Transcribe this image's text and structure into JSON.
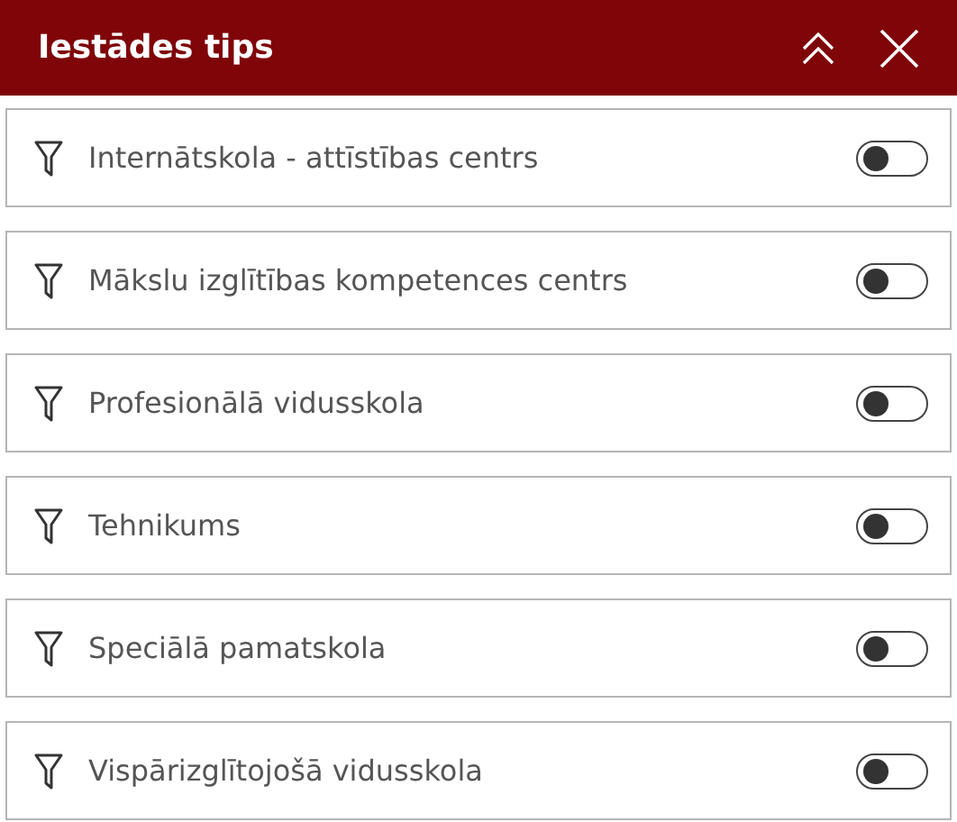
{
  "panel": {
    "title": "Iestādes tips"
  },
  "filters": [
    {
      "label": "Internātskola - attīstības centrs",
      "on": false
    },
    {
      "label": "Mākslu izglītības kompetences centrs",
      "on": false
    },
    {
      "label": "Profesionālā vidusskola",
      "on": false
    },
    {
      "label": "Tehnikums",
      "on": false
    },
    {
      "label": "Speciālā pamatskola",
      "on": false
    },
    {
      "label": "Vispārizglītojošā vidusskola",
      "on": false
    }
  ]
}
